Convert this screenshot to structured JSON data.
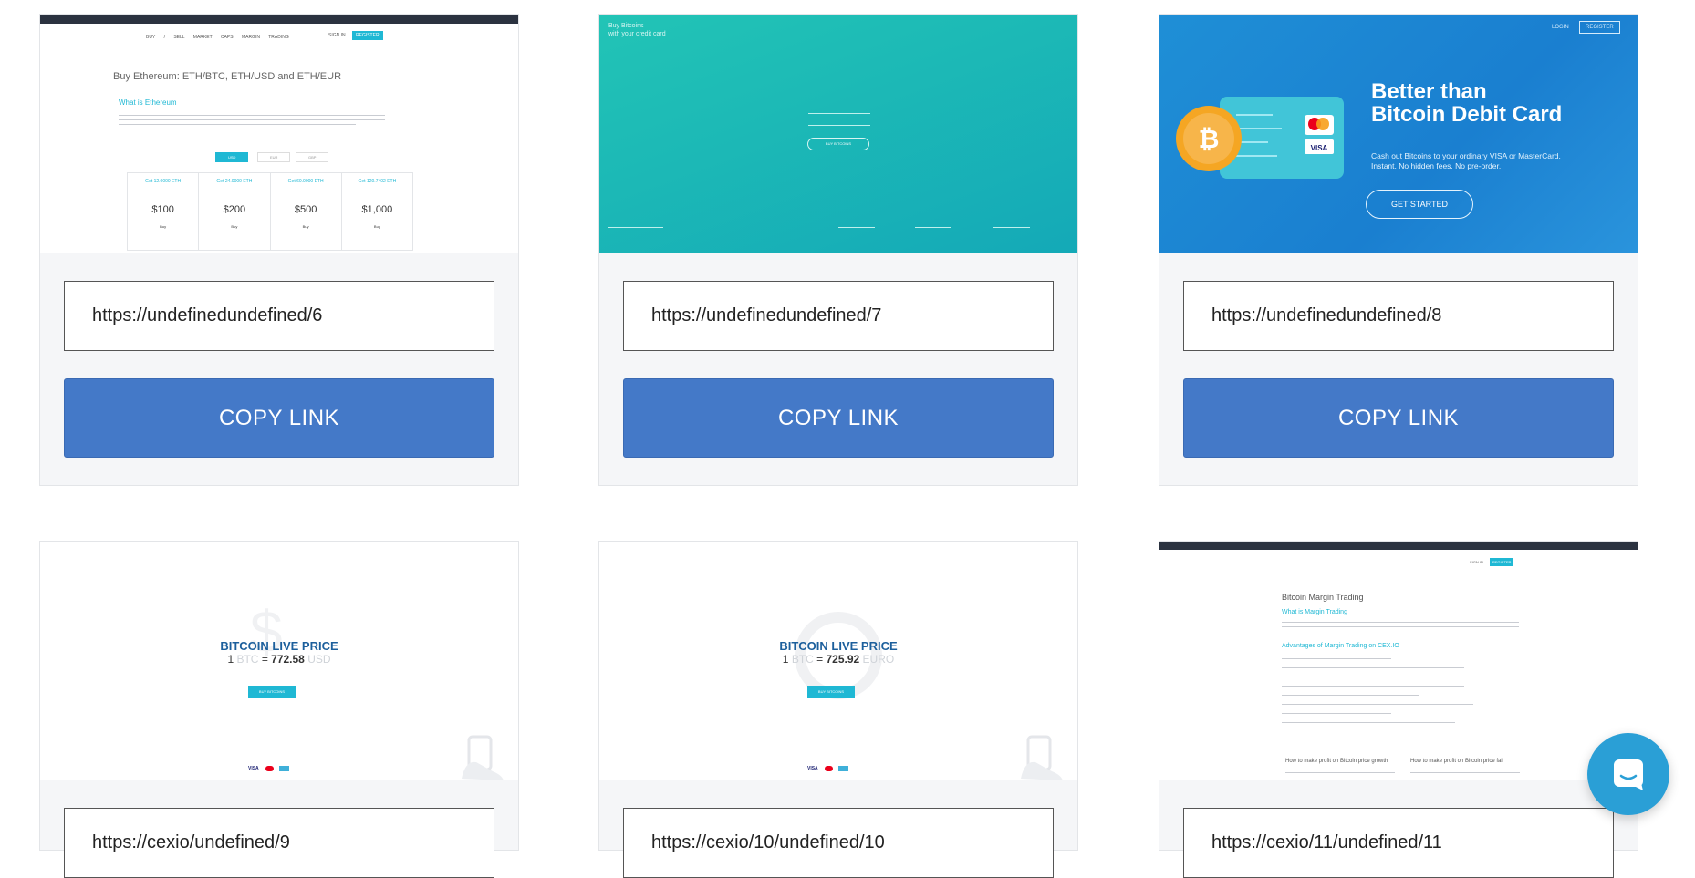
{
  "cards": [
    {
      "url": "https://undefinedundefined/6",
      "copy_label": "COPY LINK",
      "thumb": {
        "nav": [
          "BUY / SELL",
          "MARKET CAPS",
          "MARGIN TRADING"
        ],
        "signin": "SIGN IN",
        "register": "REGISTER",
        "heading": "Buy Ethereum: ETH/BTC, ETH/USD and ETH/EUR",
        "subheading": "What is Ethereum",
        "tabs": [
          "USD",
          "EUR",
          "GBP"
        ],
        "offers": [
          {
            "get": "Get 12.0000 ETH",
            "price": "$100",
            "buy": "Buy"
          },
          {
            "get": "Get 24.0000 ETH",
            "price": "$200",
            "buy": "Buy"
          },
          {
            "get": "Get 60.0000 ETH",
            "price": "$500",
            "buy": "Buy"
          },
          {
            "get": "Get 120.7402 ETH",
            "price": "$1,000",
            "buy": "Buy"
          }
        ]
      }
    },
    {
      "url": "https://undefinedundefined/7",
      "copy_label": "COPY LINK",
      "thumb": {
        "title_line1": "Buy Bitcoins",
        "title_line2": "with your credit card",
        "buy_button": "BUY BITCOINS"
      }
    },
    {
      "url": "https://undefinedundefined/8",
      "copy_label": "COPY LINK",
      "thumb": {
        "login": "LOGIN",
        "register": "REGISTER",
        "headline1": "Better than",
        "headline2": "Bitcoin Debit Card",
        "sub1": "Cash out Bitcoins to your ordinary VISA or MasterCard.",
        "sub2": "Instant. No hidden fees. No pre-order.",
        "cta": "GET STARTED",
        "card_brand": "VISA"
      }
    },
    {
      "url": "https://cexio/undefined/9",
      "copy_label": "COPY LINK",
      "thumb": {
        "title": "BITCOIN LIVE PRICE",
        "amount_prefix": "1",
        "unit_from": "BTC",
        "price": "772.58",
        "unit_to": "USD",
        "button": "BUY BITCOINS",
        "payments": "VISA"
      }
    },
    {
      "url": "https://cexio/10/undefined/10",
      "copy_label": "COPY LINK",
      "thumb": {
        "title": "BITCOIN LIVE PRICE",
        "amount_prefix": "1",
        "unit_from": "BTC",
        "price": "725.92",
        "unit_to": "EURO",
        "button": "BUY BITCOINS",
        "payments": "VISA"
      }
    },
    {
      "url": "https://cexio/11/undefined/11",
      "copy_label": "COPY LINK",
      "thumb": {
        "heading": "Bitcoin Margin Trading",
        "section1": "What is Margin Trading",
        "section2": "Advantages of Margin Trading on CEX.IO",
        "col1": "How to make profit on Bitcoin price growth",
        "col2": "How to make profit on Bitcoin price fall",
        "signin": "SIGN IN",
        "register": "REGISTER"
      }
    }
  ],
  "chat": {
    "icon": "chat-icon",
    "color": "#2a9fd6"
  }
}
